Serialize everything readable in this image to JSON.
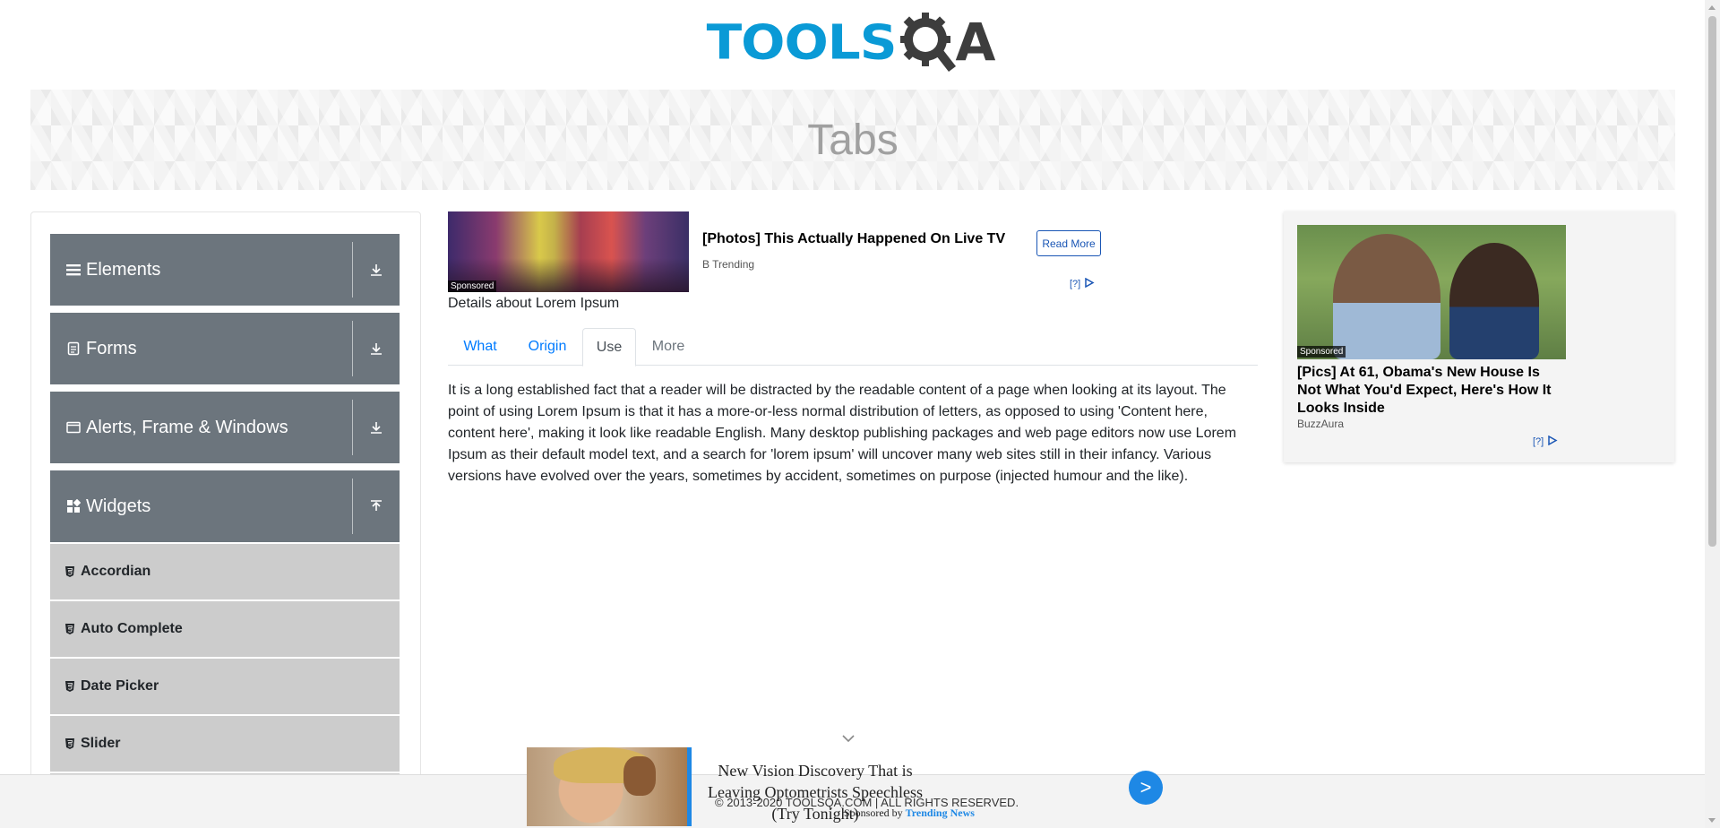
{
  "header": {
    "logo_text_blue": "TOOLS",
    "logo_text_dark": "A"
  },
  "banner": {
    "title": "Tabs"
  },
  "sidebar": {
    "groups": [
      {
        "label": "Elements",
        "icon": "hamburger-icon",
        "arrow": "download-arrow-icon"
      },
      {
        "label": "Forms",
        "icon": "file-icon",
        "arrow": "download-arrow-icon"
      },
      {
        "label": "Alerts, Frame & Windows",
        "icon": "window-icon",
        "arrow": "download-arrow-icon"
      },
      {
        "label": "Widgets",
        "icon": "widgets-grid-icon",
        "arrow": "upload-arrow-icon"
      }
    ],
    "items": [
      {
        "label": "Accordian",
        "icon": "html5-shield-icon"
      },
      {
        "label": "Auto Complete",
        "icon": "html5-shield-icon"
      },
      {
        "label": "Date Picker",
        "icon": "html5-shield-icon"
      },
      {
        "label": "Slider",
        "icon": "html5-shield-icon"
      }
    ]
  },
  "ad_top": {
    "sponsored": "Sponsored",
    "title": "[Photos] This Actually Happened On Live TV",
    "source": "B Trending",
    "button": "Read More",
    "choice": "[?]"
  },
  "content": {
    "intro": "Details about Lorem Ipsum",
    "tabs": [
      {
        "label": "What",
        "state": "link"
      },
      {
        "label": "Origin",
        "state": "link"
      },
      {
        "label": "Use",
        "state": "active"
      },
      {
        "label": "More",
        "state": "disabled"
      }
    ],
    "body": "It is a long established fact that a reader will be distracted by the readable content of a page when looking at its layout. The point of using Lorem Ipsum is that it has a more-or-less normal distribution of letters, as opposed to using 'Content here, content here', making it look like readable English. Many desktop publishing packages and web page editors now use Lorem Ipsum as their default model text, and a search for 'lorem ipsum' will uncover many web sites still in their infancy. Various versions have evolved over the years, sometimes by accident, sometimes on purpose (injected humour and the like)."
  },
  "ad_right": {
    "sponsored": "Sponsored",
    "title": "[Pics] At 61, Obama's New House Is Not What You'd Expect, Here's How It Looks Inside",
    "source": "BuzzAura",
    "choice": "[?]"
  },
  "footer": {
    "copyright": "© 2013-2020 TOOLSQA.COM | ALL RIGHTS RESERVED."
  },
  "sticky_ad": {
    "title": "New Vision Discovery That is Leaving Optometrists Speechless (Try Tonight)",
    "sponsored_by_prefix": "Sponsored by",
    "sponsor": "Trending News",
    "button": ">"
  },
  "colors": {
    "brand_blue": "#0a9ad6",
    "sidebar_group": "#6c757d",
    "sidebar_item": "#cccccc",
    "link": "#007bff",
    "ad_blue": "#1e88e5"
  }
}
